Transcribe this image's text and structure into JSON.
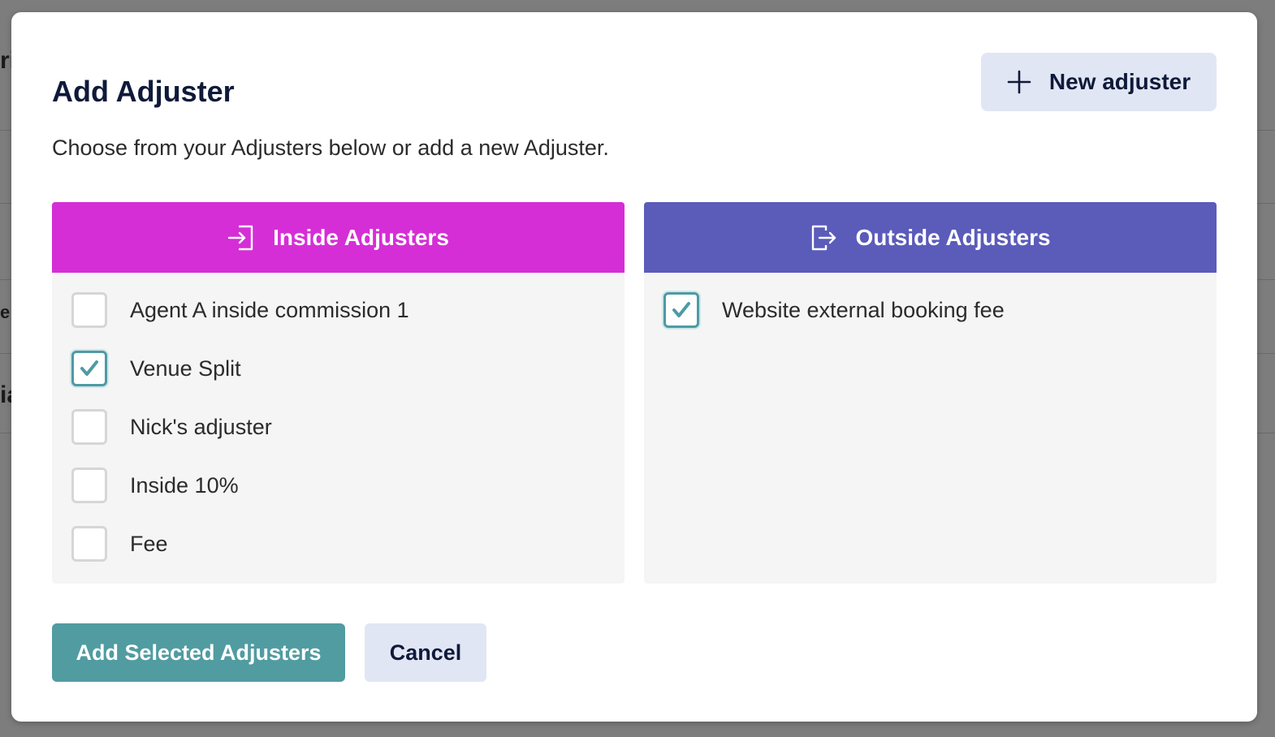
{
  "background_fragments": [
    "ri",
    "e",
    "ia"
  ],
  "dialog": {
    "title": "Add Adjuster",
    "subtitle": "Choose from your Adjusters below or add a new Adjuster.",
    "new_button_label": "New adjuster",
    "new_button_icon": "plus-icon"
  },
  "inside": {
    "title": "Inside Adjusters",
    "icon": "sign-in-icon",
    "color": "#d52ed6",
    "items": [
      {
        "label": "Agent A inside commission 1",
        "checked": false
      },
      {
        "label": "Venue Split",
        "checked": true
      },
      {
        "label": "Nick's adjuster",
        "checked": false
      },
      {
        "label": "Inside 10%",
        "checked": false
      },
      {
        "label": "Fee",
        "checked": false
      }
    ]
  },
  "outside": {
    "title": "Outside Adjusters",
    "icon": "sign-out-icon",
    "color": "#5b5bba",
    "items": [
      {
        "label": "Website external booking fee",
        "checked": true
      }
    ]
  },
  "actions": {
    "add_label": "Add Selected Adjusters",
    "add_color": "#519ca1",
    "cancel_label": "Cancel"
  }
}
